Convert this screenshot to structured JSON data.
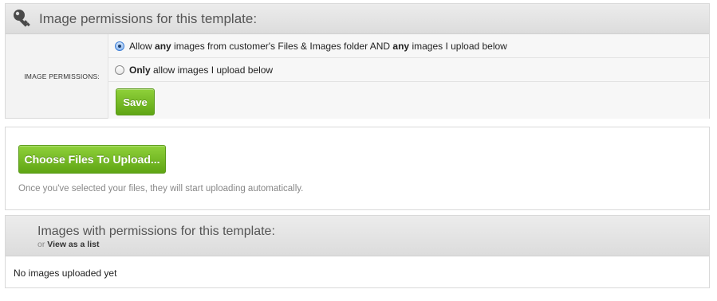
{
  "permissions": {
    "title": "Image permissions for this template:",
    "label": "IMAGE PERMISSIONS:",
    "option_any": {
      "p1": "Allow ",
      "b1": "any",
      "p2": " images from customer's Files & Images folder AND ",
      "b2": "any",
      "p3": " images I upload below",
      "selected": true
    },
    "option_only": {
      "b1": "Only",
      "p1": " allow images I upload below",
      "selected": false
    },
    "save_label": "Save"
  },
  "upload": {
    "button_label": "Choose Files To Upload...",
    "hint": "Once you've selected your files, they will start uploading automatically."
  },
  "images": {
    "title": "Images with permissions for this template:",
    "or_text": "or",
    "view_list_label": "View as a list",
    "empty_message": "No images uploaded yet"
  },
  "colors": {
    "accent_green": "#6fba1f",
    "header_gray": "#e3e3e3",
    "radio_selected": "#3d7ed6"
  },
  "icons": [
    "key-icon"
  ]
}
